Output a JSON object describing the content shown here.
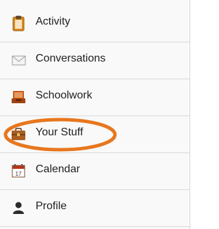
{
  "nav": {
    "items": [
      {
        "id": "activity",
        "label": "Activity",
        "icon": "clipboard-icon"
      },
      {
        "id": "conversations",
        "label": "Conversations",
        "icon": "envelope-icon"
      },
      {
        "id": "schoolwork",
        "label": "Schoolwork",
        "icon": "inbox-tray-icon"
      },
      {
        "id": "your-stuff",
        "label": "Your Stuff",
        "icon": "briefcase-icon"
      },
      {
        "id": "calendar",
        "label": "Calendar",
        "icon": "calendar-icon"
      },
      {
        "id": "profile",
        "label": "Profile",
        "icon": "person-icon"
      }
    ],
    "calendar_day": "17"
  },
  "annotation": {
    "highlight_color": "#e8771e",
    "highlighted_item": "your-stuff"
  }
}
